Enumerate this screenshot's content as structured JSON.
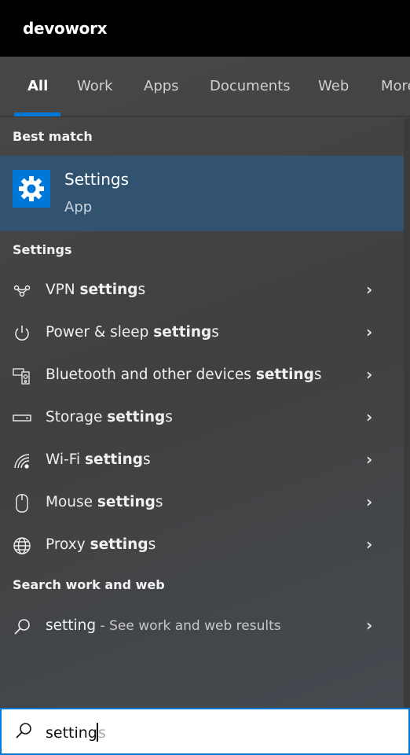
{
  "header": {
    "title": "devoworx"
  },
  "tabs": [
    {
      "label": "All",
      "active": true
    },
    {
      "label": "Work"
    },
    {
      "label": "Apps"
    },
    {
      "label": "Documents"
    },
    {
      "label": "Web"
    },
    {
      "label": "More"
    }
  ],
  "best_match": {
    "heading": "Best match",
    "name": "Settings",
    "type": "App",
    "icon": "gear-icon",
    "accent": "#0078d7"
  },
  "settings_section": {
    "heading": "Settings",
    "items": [
      {
        "prefix": "VPN ",
        "bold": "setting",
        "suffix": "s",
        "icon": "vpn-icon"
      },
      {
        "prefix": "Power & sleep ",
        "bold": "setting",
        "suffix": "s",
        "icon": "power-icon"
      },
      {
        "prefix": "Bluetooth and other devices ",
        "bold": "setting",
        "suffix": "s",
        "icon": "devices-icon"
      },
      {
        "prefix": "Storage ",
        "bold": "setting",
        "suffix": "s",
        "icon": "storage-icon"
      },
      {
        "prefix": "Wi-Fi ",
        "bold": "setting",
        "suffix": "s",
        "icon": "wifi-icon"
      },
      {
        "prefix": "Mouse ",
        "bold": "setting",
        "suffix": "s",
        "icon": "mouse-icon"
      },
      {
        "prefix": "Proxy ",
        "bold": "setting",
        "suffix": "s",
        "icon": "globe-icon"
      }
    ]
  },
  "web_section": {
    "heading": "Search work and web",
    "query": "setting",
    "hint": " - See work and web results"
  },
  "search": {
    "typed": "setting",
    "autocomplete": "s"
  }
}
